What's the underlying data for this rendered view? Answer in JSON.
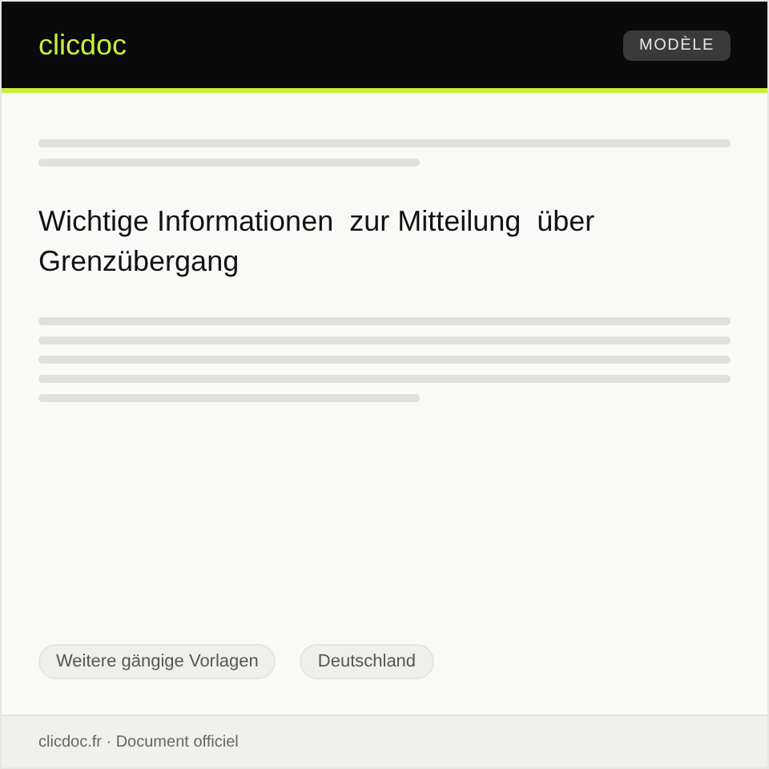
{
  "header": {
    "logo": "clicdoc",
    "badge": "MODÈLE"
  },
  "document": {
    "title": "Wichtige Informationen  zur Mitteilung  über Grenzübergang"
  },
  "tags": [
    "Weitere  gängige Vorlagen",
    "Deutschland"
  ],
  "footer": {
    "text": "clicdoc.fr · Document officiel"
  }
}
